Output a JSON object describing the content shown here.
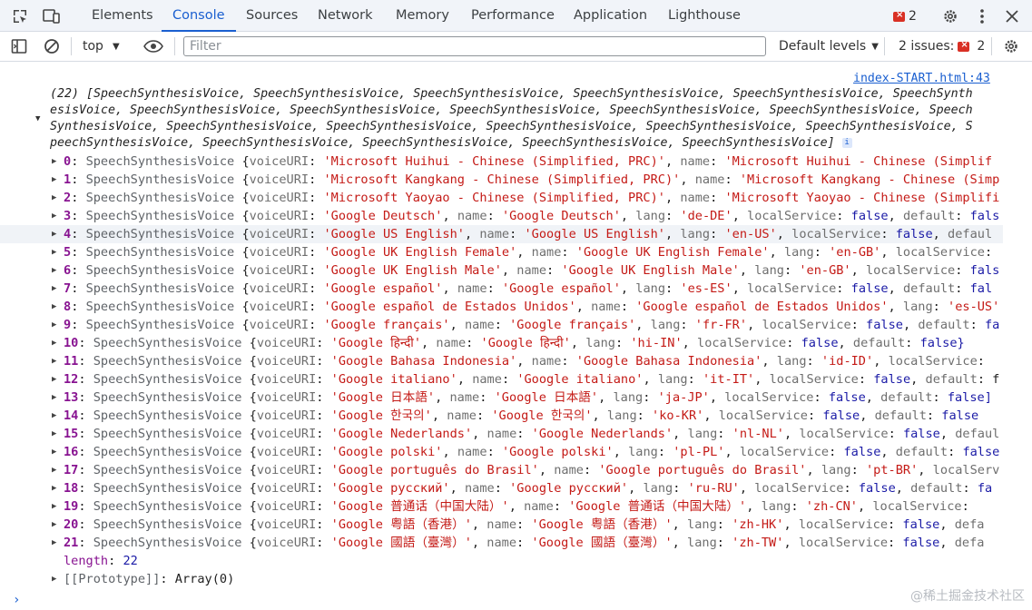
{
  "tabbar": {
    "tabs": [
      "Elements",
      "Console",
      "Sources",
      "Network",
      "Memory",
      "Performance",
      "Application",
      "Lighthouse"
    ],
    "active_tab": "Console",
    "error_count": "2"
  },
  "toolbar": {
    "context": "top",
    "filter_placeholder": "Filter",
    "levels": "Default levels",
    "issues_label": "2 issues:",
    "issues_count": "2"
  },
  "console": {
    "source_link": "index-START.html:43",
    "summary_lines": [
      "(22) [SpeechSynthesisVoice, SpeechSynthesisVoice, SpeechSynthesisVoice, SpeechSynthesisVoice, SpeechSynthesisVoice, SpeechSynth",
      "esisVoice, SpeechSynthesisVoice, SpeechSynthesisVoice, SpeechSynthesisVoice, SpeechSynthesisVoice, SpeechSynthesisVoice, Speech",
      "SynthesisVoice, SpeechSynthesisVoice, SpeechSynthesisVoice, SpeechSynthesisVoice, SpeechSynthesisVoice, SpeechSynthesisVoice, S",
      "peechSynthesisVoice, SpeechSynthesisVoice, SpeechSynthesisVoice, SpeechSynthesisVoice, SpeechSynthesisVoice]"
    ],
    "rows": [
      {
        "i": "0",
        "uri": "'Microsoft Huihui - Chinese (Simplified, PRC)'",
        "name": "'Microsoft Huihui - Chinese (Simplif"
      },
      {
        "i": "1",
        "uri": "'Microsoft Kangkang - Chinese (Simplified, PRC)'",
        "name": "'Microsoft Kangkang - Chinese (Simp"
      },
      {
        "i": "2",
        "uri": "'Microsoft Yaoyao - Chinese (Simplified, PRC)'",
        "name": "'Microsoft Yaoyao - Chinese (Simplifi"
      },
      {
        "i": "3",
        "uri": "'Google Deutsch'",
        "name": "'Google Deutsch'",
        "lang": "'de-DE'",
        "ls": "false",
        "def": "fals"
      },
      {
        "i": "4",
        "uri": "'Google US English'",
        "name": "'Google US English'",
        "lang": "'en-US'",
        "ls": "false",
        "def": "defaul",
        "deftrunc": true
      },
      {
        "i": "5",
        "uri": "'Google UK English Female'",
        "name": "'Google UK English Female'",
        "lang": "'en-GB'",
        "ls": "",
        "lstrunc": true
      },
      {
        "i": "6",
        "uri": "'Google UK English Male'",
        "name": "'Google UK English Male'",
        "lang": "'en-GB'",
        "ls": "fals",
        "lsonly": true
      },
      {
        "i": "7",
        "uri": "'Google español'",
        "name": "'Google español'",
        "lang": "'es-ES'",
        "ls": "false",
        "def": "fal"
      },
      {
        "i": "8",
        "uri": "'Google español de Estados Unidos'",
        "name": "'Google español de Estados Unidos'",
        "lang": "'es-US'"
      },
      {
        "i": "9",
        "uri": "'Google français'",
        "name": "'Google français'",
        "lang": "'fr-FR'",
        "ls": "false",
        "def": "fa"
      },
      {
        "i": "10",
        "uri": "'Google हिन्दी'",
        "name": "'Google हिन्दी'",
        "lang": "'hi-IN'",
        "ls": "false",
        "def": "false}",
        "closed": true
      },
      {
        "i": "11",
        "uri": "'Google Bahasa Indonesia'",
        "name": "'Google Bahasa Indonesia'",
        "lang": "'id-ID'",
        "ls": "",
        "lstrunc": true
      },
      {
        "i": "12",
        "uri": "'Google italiano'",
        "name": "'Google italiano'",
        "lang": "'it-IT'",
        "ls": "false",
        "def": "",
        "deftrunc": true
      },
      {
        "i": "13",
        "uri": "'Google 日本語'",
        "name": "'Google 日本語'",
        "lang": "'ja-JP'",
        "ls": "false",
        "def": "false]"
      },
      {
        "i": "14",
        "uri": "'Google 한국의'",
        "name": "'Google 한국의'",
        "lang": "'ko-KR'",
        "ls": "false",
        "def": "false"
      },
      {
        "i": "15",
        "uri": "'Google Nederlands'",
        "name": "'Google Nederlands'",
        "lang": "'nl-NL'",
        "ls": "false",
        "def": "defaul",
        "deftrunc": true
      },
      {
        "i": "16",
        "uri": "'Google polski'",
        "name": "'Google polski'",
        "lang": "'pl-PL'",
        "ls": "false",
        "def": "false"
      },
      {
        "i": "17",
        "uri": "'Google português do Brasil'",
        "name": "'Google português do Brasil'",
        "lang": "'pt-BR'",
        "ls": "localServ",
        "lsrawtrunc": true
      },
      {
        "i": "18",
        "uri": "'Google русский'",
        "name": "'Google русский'",
        "lang": "'ru-RU'",
        "ls": "false",
        "def": "fa"
      },
      {
        "i": "19",
        "uri": "'Google 普通话（中国大陆）'",
        "name": "'Google 普通话（中国大陆）'",
        "lang": "'zh-CN'",
        "ls": "",
        "lstrunc": true
      },
      {
        "i": "20",
        "uri": "'Google 粤語（香港）'",
        "name": "'Google 粤語（香港）'",
        "lang": "'zh-HK'",
        "ls": "false",
        "def": "defa",
        "deftrunc": true
      },
      {
        "i": "21",
        "uri": "'Google 國語（臺灣）'",
        "name": "'Google 國語（臺灣）'",
        "lang": "'zh-TW'",
        "ls": "false",
        "def": "defa",
        "deftrunc": true
      }
    ],
    "length_label": "length",
    "length_value": "22",
    "prototype_label": "[[Prototype]]",
    "prototype_value": "Array(0)",
    "class_name": "SpeechSynthesisVoice"
  },
  "watermark": "@稀土掘金技术社区"
}
